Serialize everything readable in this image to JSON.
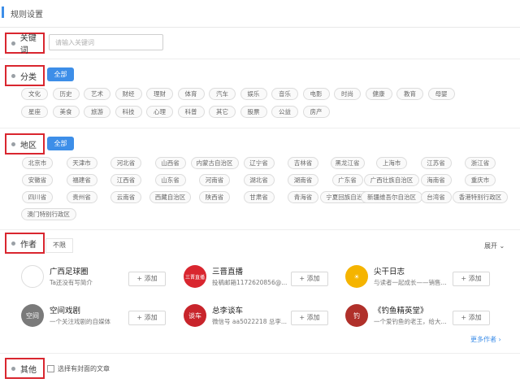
{
  "header": {
    "title": "规则设置"
  },
  "keyword": {
    "label": "关键词",
    "placeholder": "请输入关键词"
  },
  "category": {
    "label": "分类",
    "all_label": "全部",
    "items": [
      "文化",
      "历史",
      "艺术",
      "财经",
      "理财",
      "体育",
      "汽车",
      "娱乐",
      "音乐",
      "电影",
      "时尚",
      "健康",
      "教育",
      "母婴",
      "星座",
      "美食",
      "旅游",
      "科技",
      "心理",
      "科普",
      "其它",
      "股票",
      "公益",
      "房产"
    ]
  },
  "region": {
    "label": "地区",
    "all_label": "全部",
    "items": [
      "北京市",
      "天津市",
      "河北省",
      "山西省",
      "内蒙古自治区",
      "辽宁省",
      "吉林省",
      "黑龙江省",
      "上海市",
      "江苏省",
      "浙江省",
      "安徽省",
      "福建省",
      "江西省",
      "山东省",
      "河南省",
      "湖北省",
      "湖南省",
      "广东省",
      "广西壮族自治区",
      "海南省",
      "重庆市",
      "四川省",
      "贵州省",
      "云南省",
      "西藏自治区",
      "陕西省",
      "甘肃省",
      "青海省",
      "宁夏回族自治区",
      "新疆维吾尔自治区",
      "台湾省",
      "香港特别行政区",
      "澳门特别行政区"
    ]
  },
  "author": {
    "label": "作者",
    "unlimited_label": "不限",
    "expand_label": "展开 ⌄",
    "add_label": "+ 添加",
    "more_label": "更多作者 ›",
    "cards": [
      {
        "name": "广西足球圈",
        "desc": "Ta还没有写简介",
        "avatar": "",
        "color": "#ffffff"
      },
      {
        "name": "三晋直播",
        "desc": "投稿邮箱1172620856@...",
        "avatar": "三晋直播",
        "color": "#d9262f"
      },
      {
        "name": "尖干日志",
        "desc": "与读者一起成长——销售...",
        "avatar": "☀",
        "color": "#f5b400"
      },
      {
        "name": "空间戏剧",
        "desc": "一个关注戏剧的自媒体",
        "avatar": "空间",
        "color": "#7a7a7a"
      },
      {
        "name": "总李谈车",
        "desc": "微信号 aa5022218 总李...",
        "avatar": "谈车",
        "color": "#c8242b"
      },
      {
        "name": "《钓鱼精英堂》",
        "desc": "一个爱钓鱼的老王，给大...",
        "avatar": "钓",
        "color": "#b0302a"
      }
    ]
  },
  "other": {
    "label": "其他",
    "checkbox_label": "选择有封面的文章"
  }
}
